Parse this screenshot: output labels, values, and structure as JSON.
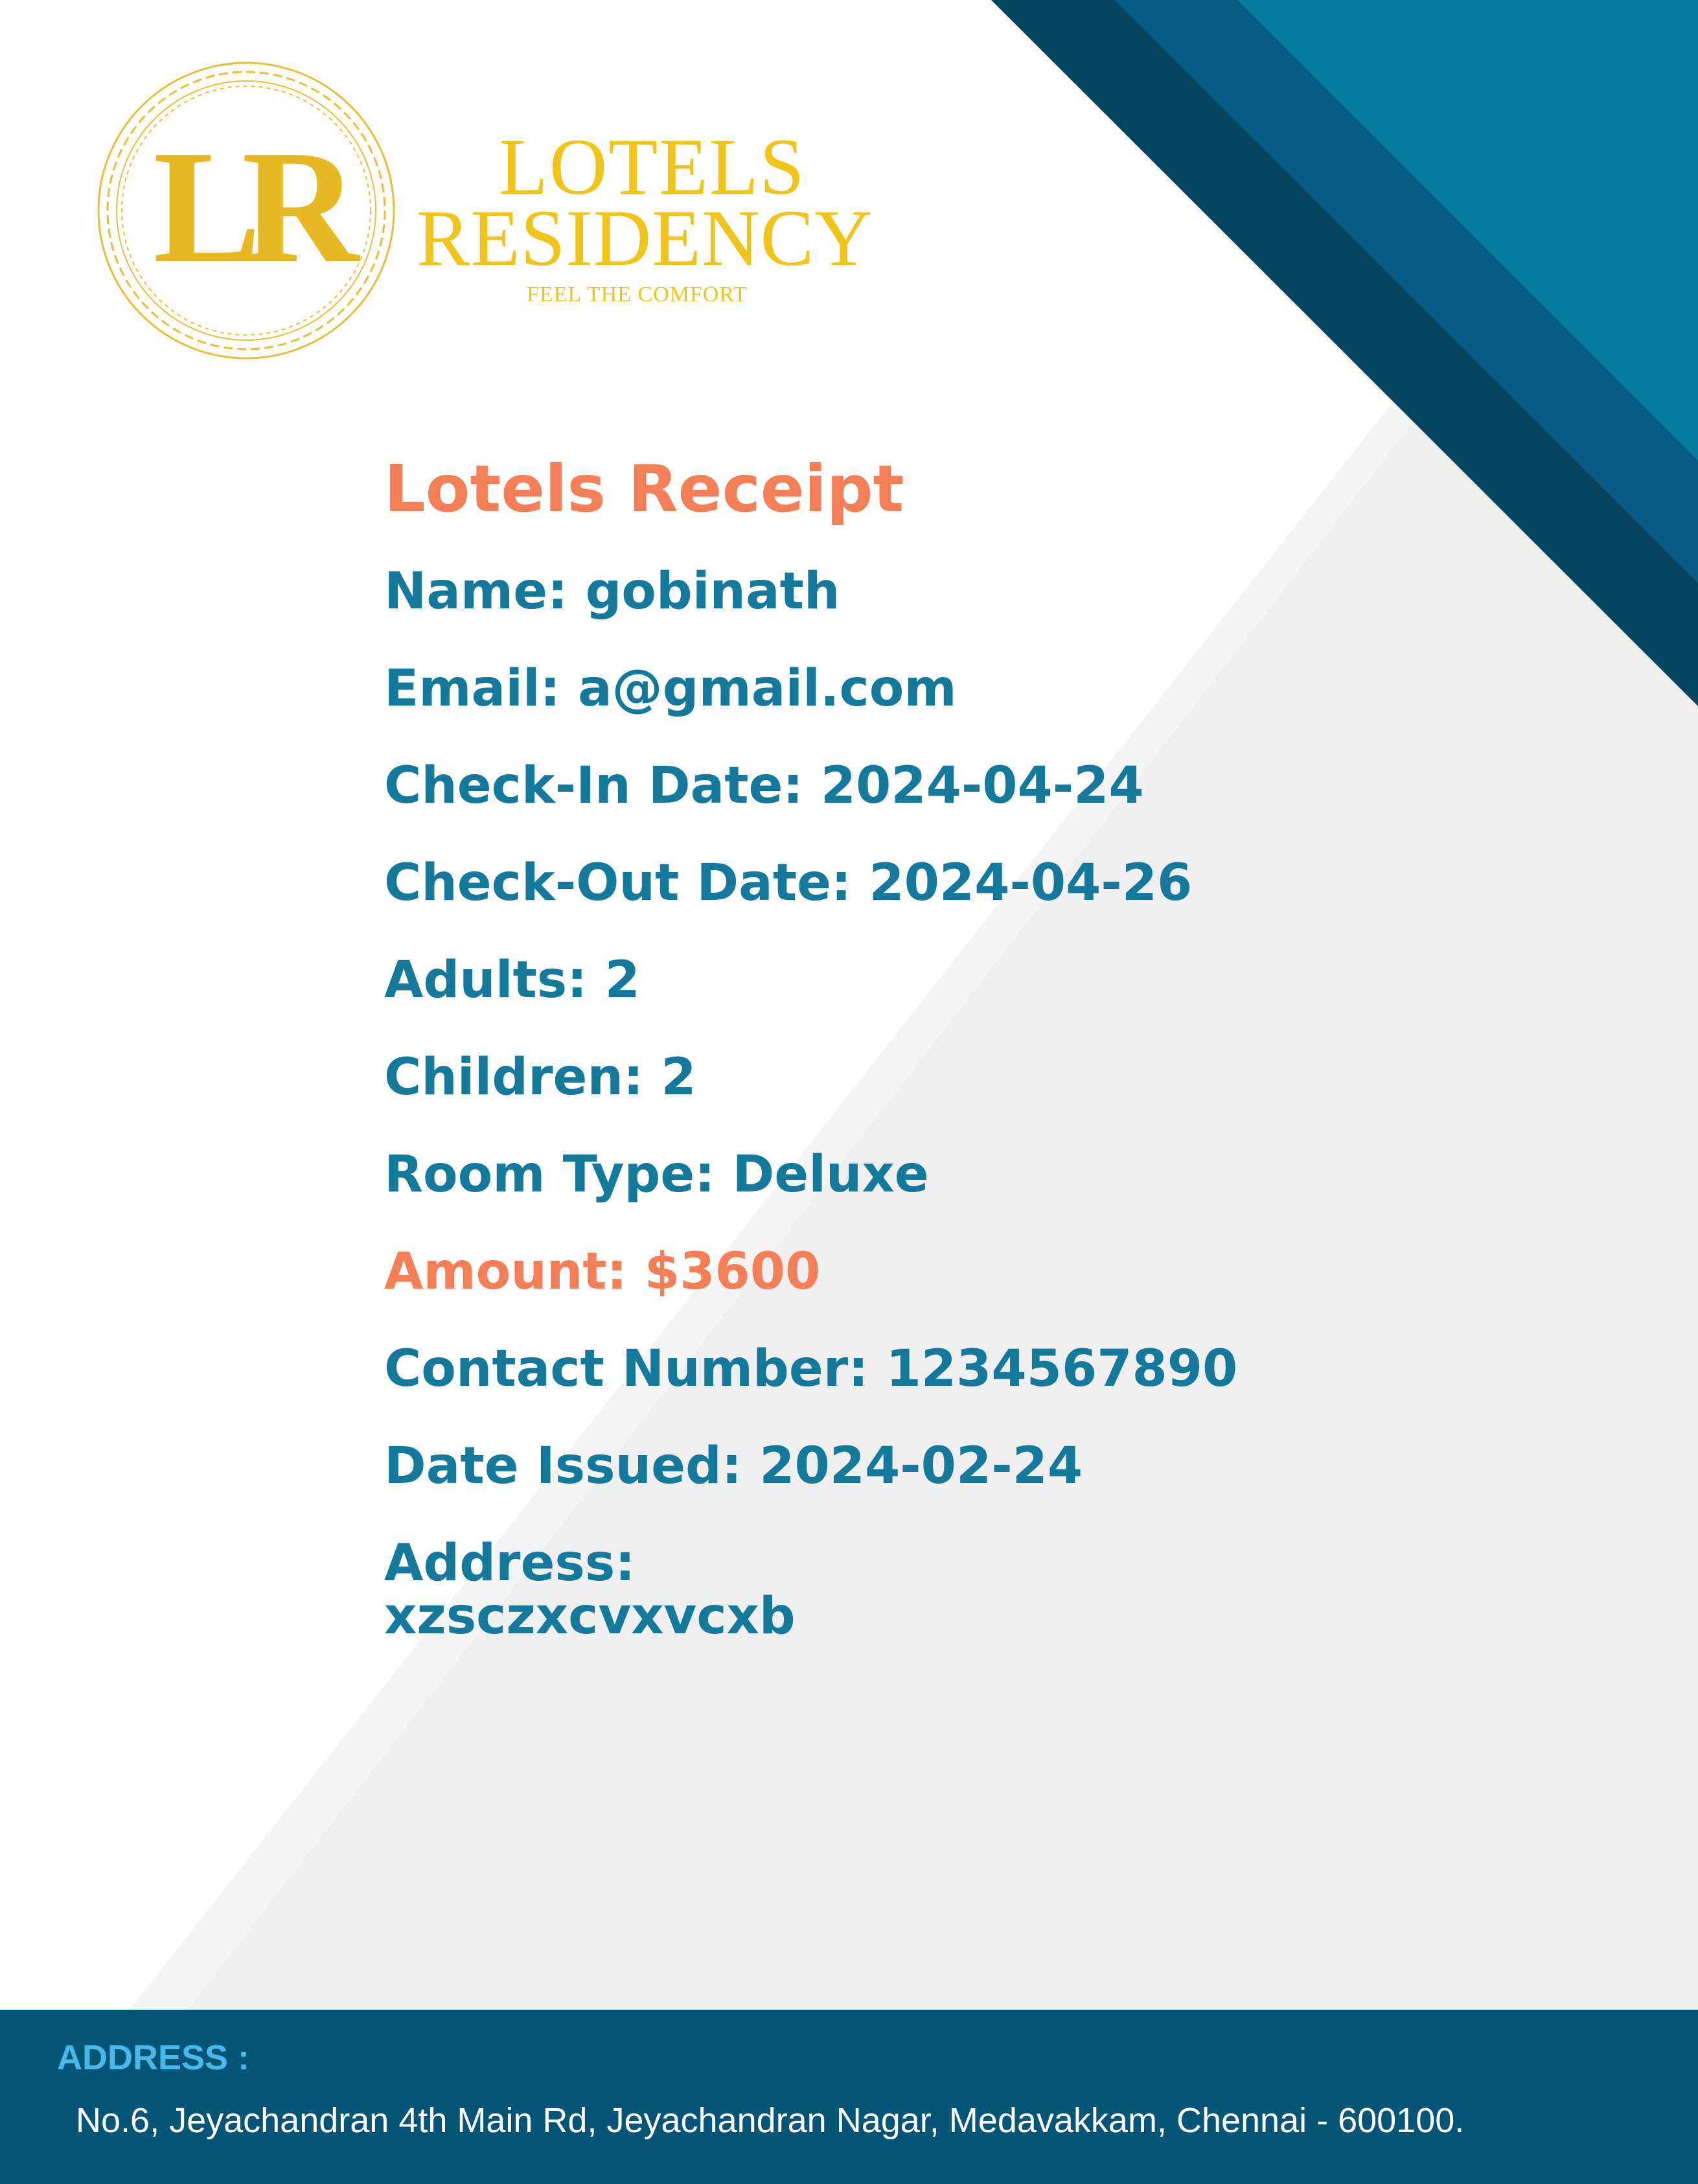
{
  "brand": {
    "monogram": "LR",
    "name_line1": "LOTELS",
    "name_line2": "RESIDENCY",
    "tagline": "FEEL THE COMFORT"
  },
  "receipt": {
    "title": "Lotels Receipt",
    "name": "Name: gobinath",
    "email": "Email: a@gmail.com",
    "check_in": "Check-In Date: 2024-04-24",
    "check_out": "Check-Out Date: 2024-04-26",
    "adults": "Adults: 2",
    "children": "Children: 2",
    "room_type": "Room Type: Deluxe",
    "amount": "Amount: $3600",
    "contact": "Contact Number: 1234567890",
    "date_issued": "Date Issued: 2024-02-24",
    "address_label": "Address:",
    "address_value": "xzsczxcvxvcxb"
  },
  "footer": {
    "heading": "ADDRESS :",
    "text": "No.6, Jeyachandran 4th Main Rd, Jeyachandran Nagar, Medavakkam, Chennai - 600100."
  },
  "colors": {
    "accent_orange": "#f47e56",
    "text_teal": "#14799a",
    "brand_gold": "#f0c419",
    "footer_navy": "#055576",
    "footer_label": "#4ab8ea",
    "stripe_dark": "#06445f",
    "stripe_mid": "#055b80",
    "stripe_light": "#047aa0",
    "panel_gray": "#f0eff0"
  }
}
